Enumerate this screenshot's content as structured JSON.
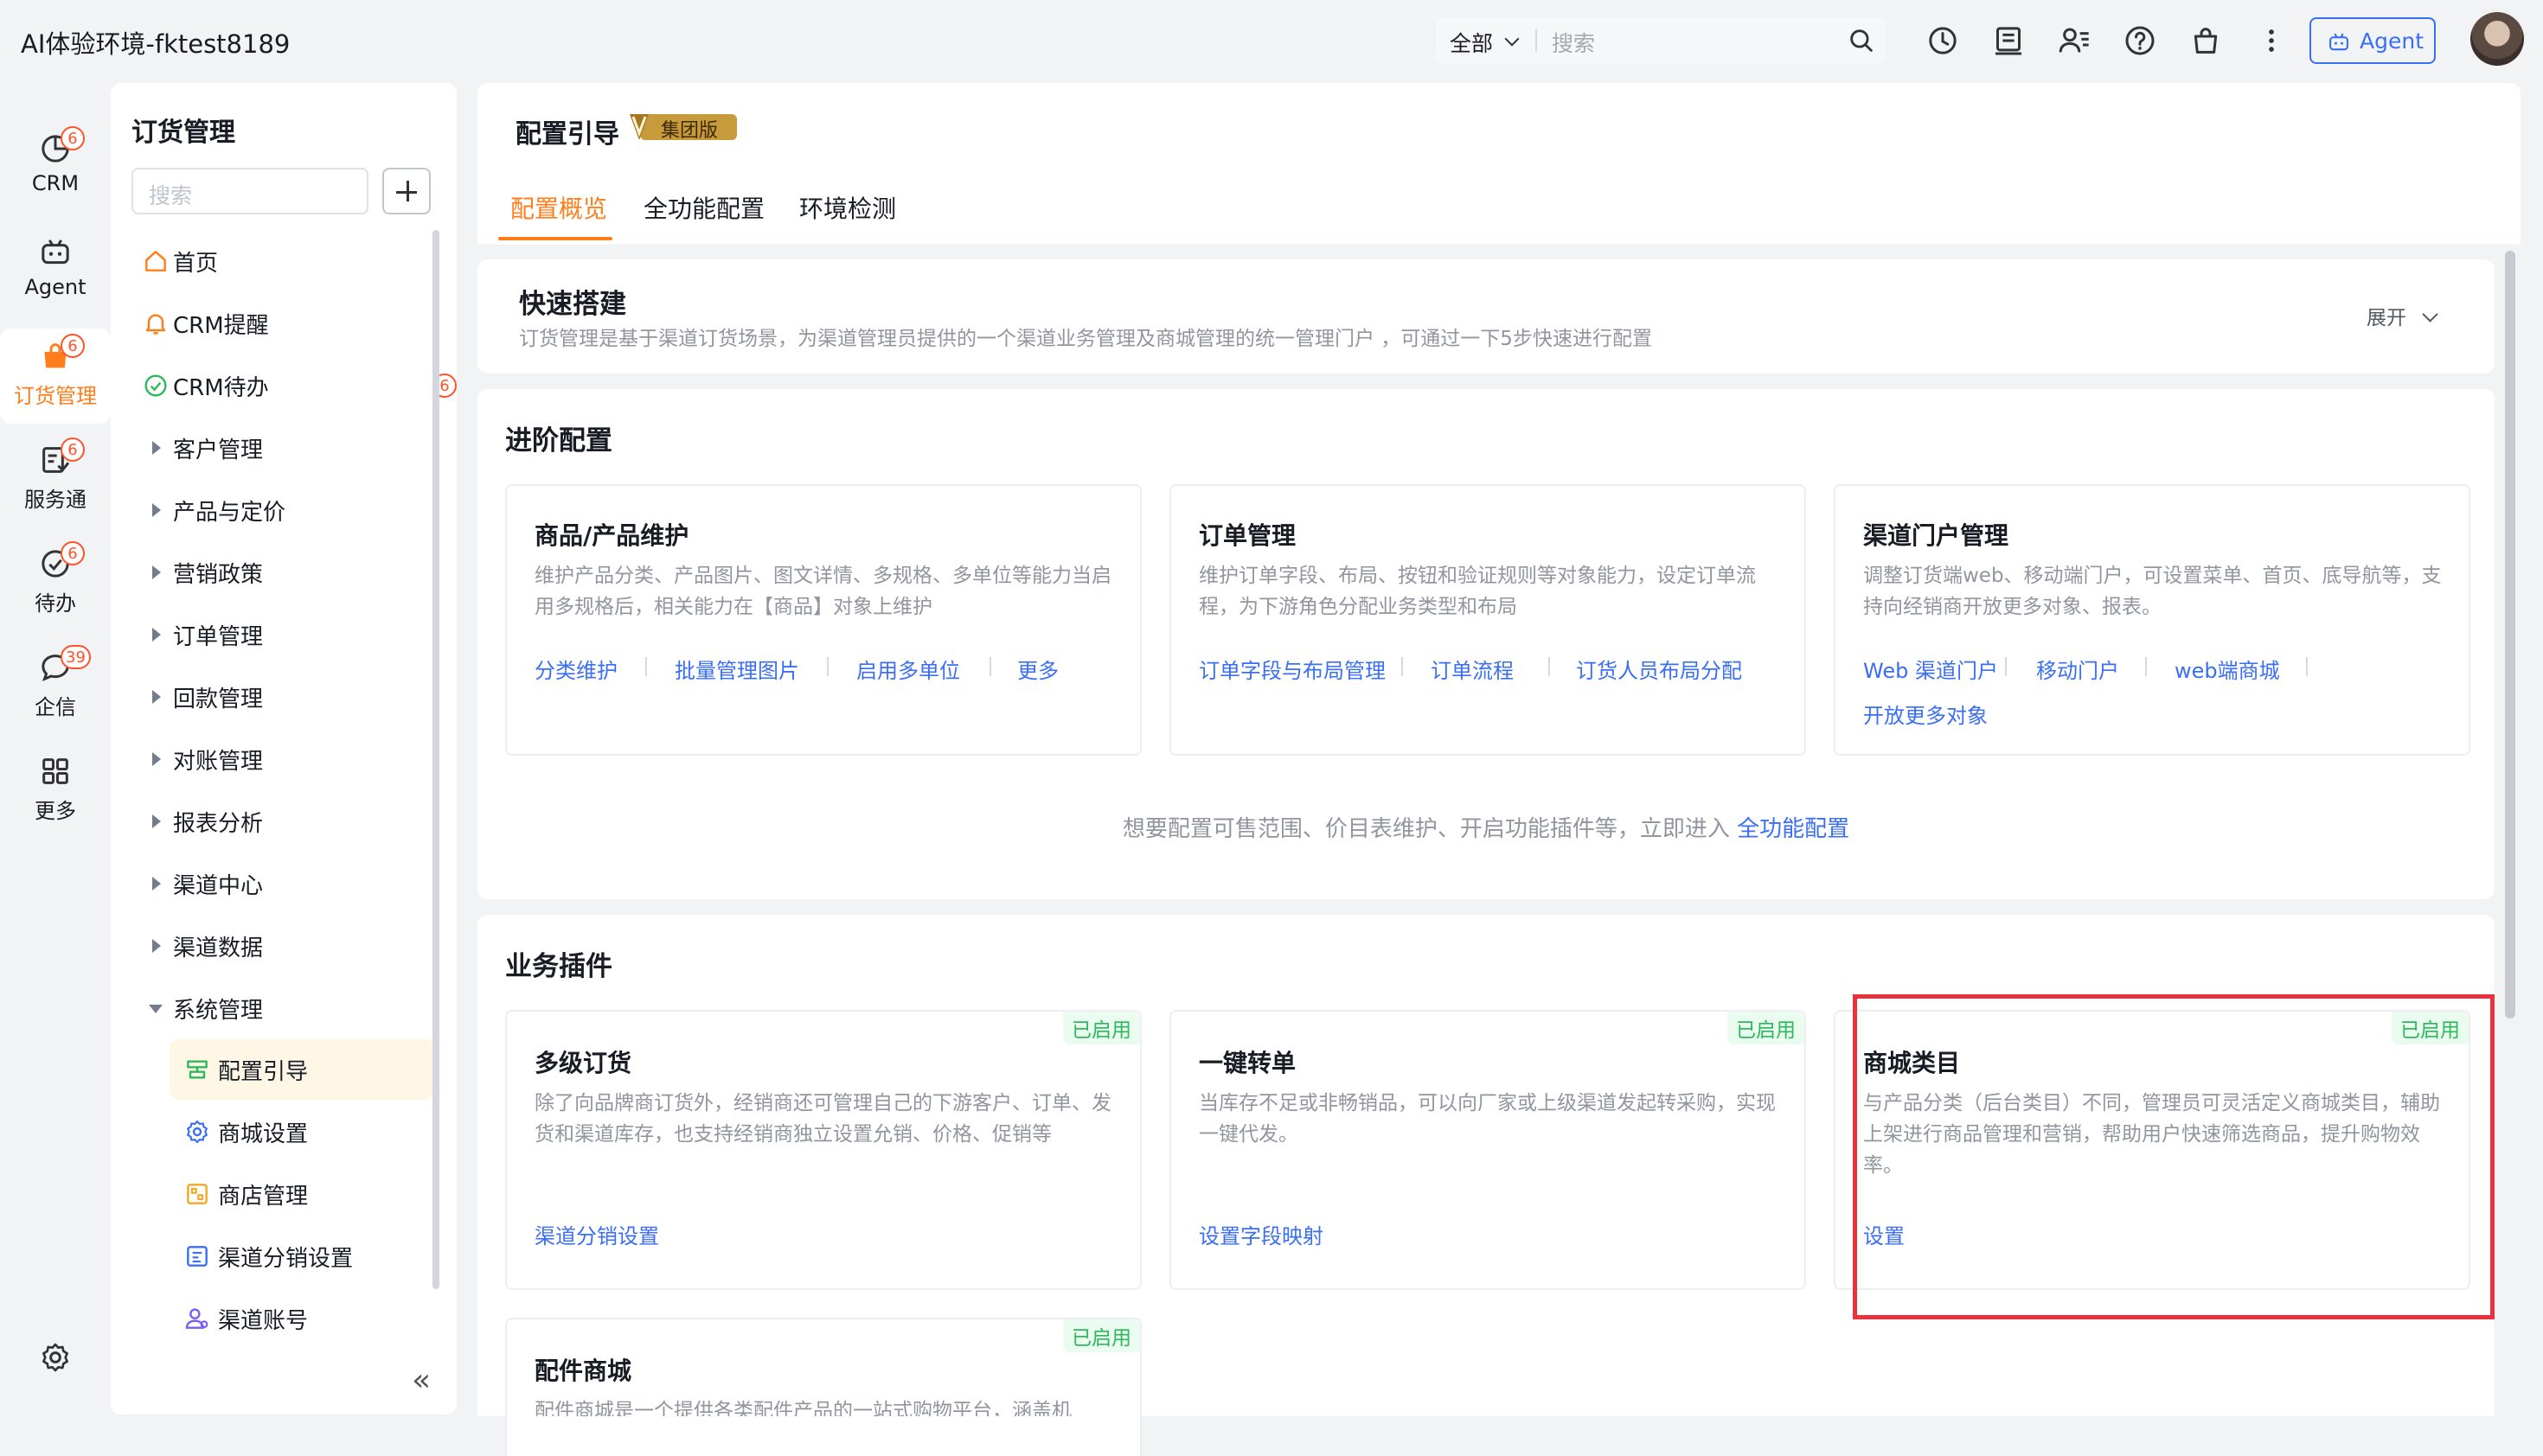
{
  "app": {
    "title": "AI体验环境-fktest8189"
  },
  "topbar": {
    "search_scope": "全部",
    "search_placeholder": "搜索",
    "agent_label": "Agent",
    "icons": [
      "history-icon",
      "notes-icon",
      "contacts-icon",
      "help-icon",
      "shop-icon",
      "more-icon"
    ]
  },
  "rail": {
    "items": [
      {
        "label": "CRM",
        "badge": "6",
        "icon": "crm-icon"
      },
      {
        "label": "Agent",
        "badge": "",
        "icon": "robot-icon"
      },
      {
        "label": "订货管理",
        "badge": "6",
        "icon": "order-bag-icon",
        "active": true
      },
      {
        "label": "服务通",
        "badge": "6",
        "icon": "service-icon"
      },
      {
        "label": "待办",
        "badge": "6",
        "icon": "todo-icon"
      },
      {
        "label": "企信",
        "badge": "39",
        "icon": "chat-icon"
      },
      {
        "label": "更多",
        "badge": "",
        "icon": "grid-icon"
      }
    ]
  },
  "sidebar": {
    "title": "订货管理",
    "search_placeholder": "搜索",
    "items": [
      {
        "label": "首页"
      },
      {
        "label": "CRM提醒"
      },
      {
        "label": "CRM待办",
        "badge": "6"
      },
      {
        "label": "客户管理"
      },
      {
        "label": "产品与定价"
      },
      {
        "label": "营销政策"
      },
      {
        "label": "订单管理"
      },
      {
        "label": "回款管理"
      },
      {
        "label": "对账管理"
      },
      {
        "label": "报表分析"
      },
      {
        "label": "渠道中心"
      },
      {
        "label": "渠道数据"
      },
      {
        "label": "系统管理"
      }
    ],
    "sub_items": [
      {
        "label": "配置引导",
        "active": true
      },
      {
        "label": "商城设置"
      },
      {
        "label": "商店管理"
      },
      {
        "label": "渠道分销设置"
      },
      {
        "label": "渠道账号"
      }
    ]
  },
  "main": {
    "title": "配置引导",
    "badge": "集团版",
    "tabs": [
      "配置概览",
      "全功能配置",
      "环境检测"
    ],
    "quick": {
      "title": "快速搭建",
      "desc": "订货管理是基于渠道订货场景，为渠道管理员提供的一个渠道业务管理及商城管理的统一管理门户 ，可通过一下5步快速进行配置",
      "expand": "展开"
    },
    "advanced": {
      "title": "进阶配置",
      "cards": [
        {
          "title": "商品/产品维护",
          "desc": "维护产品分类、产品图片、图文详情、多规格、多单位等能力当启用多规格后，相关能力在【商品】对象上维护",
          "links": [
            "分类维护",
            "批量管理图片",
            "启用多单位",
            "更多"
          ]
        },
        {
          "title": "订单管理",
          "desc": "维护订单字段、布局、按钮和验证规则等对象能力，设定订单流程，为下游角色分配业务类型和布局",
          "links": [
            "订单字段与布局管理",
            "订单流程",
            "订货人员布局分配"
          ]
        },
        {
          "title": "渠道门户管理",
          "desc": "调整订货端web、移动端门户，可设置菜单、首页、底导航等，支持向经销商开放更多对象、报表。",
          "links": [
            "Web 渠道门户",
            "移动门户",
            "web端商城",
            "开放更多对象"
          ]
        }
      ],
      "footer_text": "想要配置可售范围、价目表维护、开启功能插件等，立即进入",
      "footer_link": "全功能配置"
    },
    "plugins": {
      "title": "业务插件",
      "cards": [
        {
          "title": "多级订货",
          "tag": "已启用",
          "desc": "除了向品牌商订货外，经销商还可管理自己的下游客户、订单、发货和渠道库存，也支持经销商独立设置允销、价格、促销等",
          "link": "渠道分销设置"
        },
        {
          "title": "一键转单",
          "tag": "已启用",
          "desc": "当库存不足或非畅销品，可以向厂家或上级渠道发起转采购，实现一键代发。",
          "link": "设置字段映射"
        },
        {
          "title": "商城类目",
          "tag": "已启用",
          "desc": "与产品分类（后台类目）不同，管理员可灵活定义商城类目，辅助上架进行商品管理和营销，帮助用户快速筛选商品，提升购物效率。",
          "link": "设置"
        },
        {
          "title": "配件商城",
          "tag": "已启用",
          "desc": "配件商城是一个提供各类配件产品的一站式购物平台，涵盖机"
        }
      ]
    },
    "highlight_color": "#e8333f"
  }
}
